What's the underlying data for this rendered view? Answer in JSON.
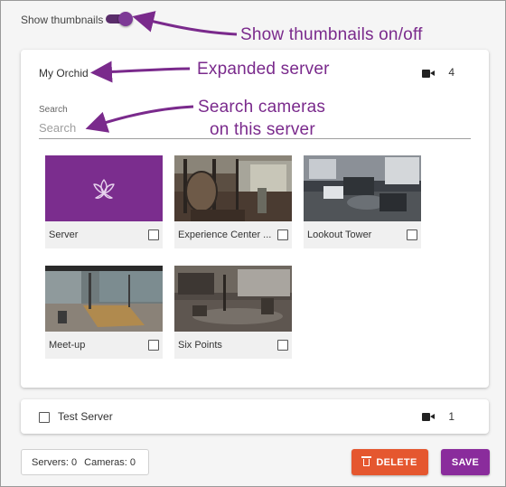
{
  "header": {
    "show_thumbnails_label": "Show thumbnails",
    "show_thumbnails_on": true
  },
  "server": {
    "name": "My Orchid",
    "camera_count": "4",
    "search_label": "Search",
    "search_placeholder": "Search",
    "tiles": [
      {
        "label": "Server"
      },
      {
        "label": "Experience Center ..."
      },
      {
        "label": "Lookout Tower"
      },
      {
        "label": "Meet-up"
      },
      {
        "label": "Six Points"
      }
    ]
  },
  "test_server": {
    "name": "Test Server",
    "camera_count": "1"
  },
  "footer": {
    "servers": "Servers: 0",
    "cameras": "Cameras: 0",
    "delete_label": "DELETE",
    "save_label": "SAVE"
  },
  "annotations": {
    "toggle": "Show thumbnails on/off",
    "expanded": "Expanded server",
    "search_line1": "Search cameras",
    "search_line2": "on this server"
  },
  "colors": {
    "accent": "#7b2d8e",
    "delete": "#e5572f",
    "save": "#8a2c9c"
  }
}
